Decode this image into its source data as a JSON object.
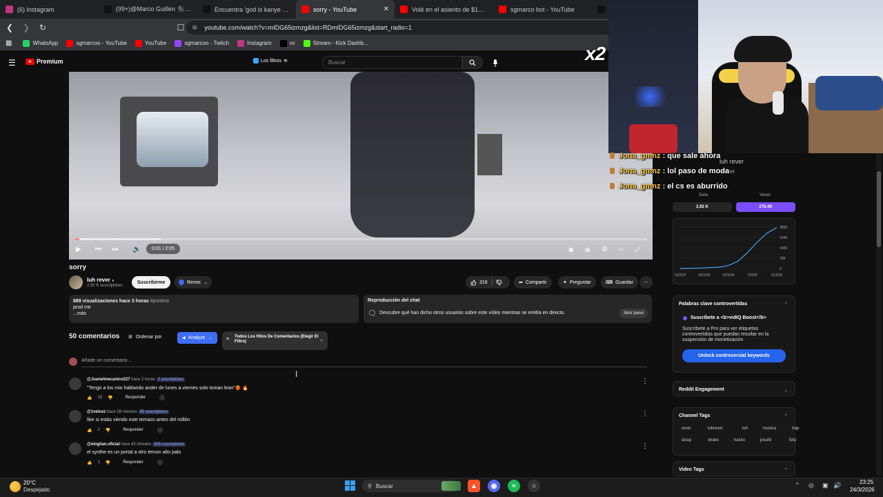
{
  "browser": {
    "tabs": [
      {
        "label": "(6) Instagram",
        "color": "#c13584"
      },
      {
        "label": "(99+)@Marco Guillen 🐈‍⬛ #pa",
        "color": "#111111"
      },
      {
        "label": "Encuentra 'god is kanye west' e",
        "color": "#111111"
      },
      {
        "label": "sorry - YouTube",
        "color": "#ff0000"
      },
      {
        "label": "Volé en el asiento de $15,000 d",
        "color": "#ff0000"
      },
      {
        "label": "sgmarco bot - YouTube",
        "color": "#ff0000"
      },
      {
        "label": "",
        "color": "#111111"
      }
    ],
    "url": "youtube.com/watch?v=mIDG65izmzg&list=RDmIDG65izmzg&start_radio=1",
    "bookmarks": [
      {
        "label": "WhatsApp",
        "color": "#25d366"
      },
      {
        "label": "sgmarcoo - YouTube",
        "color": "#ff0000"
      },
      {
        "label": "YouTube",
        "color": "#ff0000"
      },
      {
        "label": "sgmarcoo - Twitch",
        "color": "#9146ff"
      },
      {
        "label": "Instagram",
        "color": "#c13584"
      },
      {
        "label": "vv",
        "color": "#000000"
      },
      {
        "label": "Stream - Kick Dashb...",
        "color": "#53fc18"
      }
    ]
  },
  "youtube": {
    "logo_text": "Premium",
    "filters_chip": "Los filtros",
    "search_placeholder": "Buscar",
    "player": {
      "time": "0:01 / 2:05",
      "progress": 0.008,
      "buffered": 0.15
    },
    "video_title": "sorry",
    "channel": {
      "name": "luh rever",
      "subs": "2,92 K suscriptores"
    },
    "subscribe_label": "Suscribirme",
    "remix_label": "Remix",
    "actions": {
      "likes": "316",
      "share": "Compartir",
      "ask": "Preguntar",
      "save": "Guardar"
    },
    "description": {
      "line1": "889 visualizaciones  hace 3 horas",
      "hashtag": "#prodme",
      "line2": "prod me",
      "more": "...más"
    },
    "chat_replay": {
      "title": "Reproducción del chat",
      "desc": "Descubre qué han dicho otros usuarios sobre este vídeo mientras se emitía en directo.",
      "button": "Abrir panel"
    },
    "comments": {
      "count": "50 comentarios",
      "sort_label": "Ordenar por",
      "analyze_label": "Analyze",
      "thread_filter": "Todos Los Hilos De Comentarios (Elegir El Filtro)",
      "add_placeholder": "Añade un comentario...",
      "items": [
        {
          "user": "@Juanelmecanico227",
          "time": "hace 2 horas",
          "subs": "2 suscriptores",
          "text": "\"Tengo a los mio hablando ander de lunes a viernes solo toman lean\"❤️‍🔥 🔥",
          "likes": "15",
          "reply": "Responder"
        },
        {
          "user": "@1velcez",
          "time": "hace 58 minutos",
          "subs": "65 suscriptores",
          "text": "like si estás viendo este temazo antes del millón",
          "likes": "2",
          "reply": "Responder"
        },
        {
          "user": "@elogiian.oficial",
          "time": "hace 43 minutos",
          "subs": "358 suscriptores",
          "text": "el synthe es un portal a otro temon alto palo",
          "likes": "1",
          "reply": "Responder"
        }
      ]
    }
  },
  "vidiq": {
    "stats": {
      "subs_label": "Subs",
      "views_label": "Views",
      "subs_value": "2,92 K",
      "views_value": "276.4K"
    },
    "chart_data": {
      "type": "line",
      "x": [
        "13/2/22",
        "26/1/23",
        "22/1/24",
        "5/3/25",
        "21/3/26"
      ],
      "y_ticks": [
        "280K",
        "210K",
        "140K",
        "70K",
        "0"
      ],
      "ylim": [
        0,
        280000
      ],
      "series": [
        {
          "values": [
            0,
            1000,
            3000,
            6000,
            9000,
            20000,
            50000,
            110000,
            180000,
            240000,
            276400
          ]
        }
      ]
    },
    "keywords": {
      "title": "Palabras clave controvertidas",
      "promo": "Suscríbete a <b>vidIQ Boost</b>",
      "desc": "Suscríbete a Pro para ver etiquetas controvertidas que puedan resultar en la suspensión de monetización",
      "button": "Unlock controversial keywords"
    },
    "reddit_title": "Reddit Engagement",
    "channel_tags_title": "Channel Tags",
    "channel_tags": [
      "rever",
      "luhrever",
      "luh",
      "musica",
      "trap",
      "sisop",
      "shako",
      "hasko",
      "josufd",
      "feliz"
    ],
    "video_tags_title": "Video Tags"
  },
  "stream_overlay": {
    "multiplier": "x2",
    "chat": [
      {
        "user": "Jona_gmnz",
        "text": ": que sale ahora"
      },
      {
        "user": "Jona_gmnz",
        "text": ": lol paso de moda"
      },
      {
        "user": "Jona_gmnz",
        "text": ": el cs es aburrido"
      }
    ],
    "ghost_channel": "luh rever",
    "ghost_subs": "rever"
  },
  "taskbar": {
    "temp": "20°C",
    "weather": "Despejado",
    "search": "Buscar",
    "time": "23:25",
    "date": "24/3/2026"
  }
}
